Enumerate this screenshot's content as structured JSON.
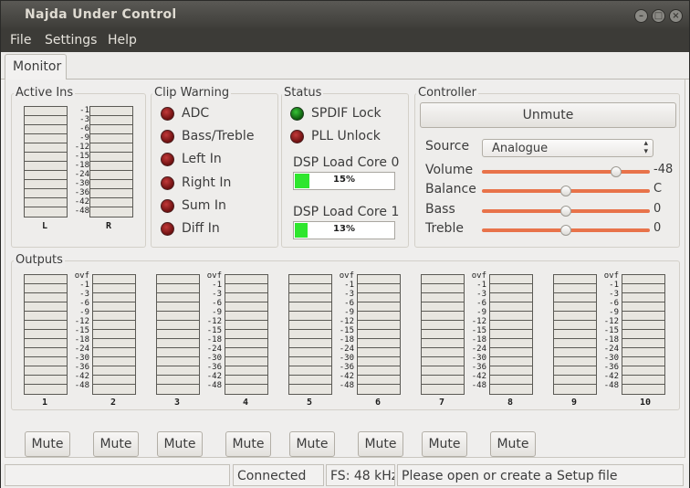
{
  "window": {
    "title": "Najda Under Control",
    "buttons": [
      "–",
      "□",
      "×"
    ]
  },
  "menu": [
    "File",
    "Settings",
    "Help"
  ],
  "tabs": [
    "Monitor"
  ],
  "scale_labels": [
    "-1",
    "-3",
    "-6",
    "-9",
    "-12",
    "-15",
    "-18",
    "-24",
    "-30",
    "-36",
    "-42",
    "-48"
  ],
  "overflow_label": "ovf",
  "active_ins": {
    "title": "Active Ins",
    "left_label": "L",
    "right_label": "R"
  },
  "clip_warning": {
    "title": "Clip Warning",
    "items": [
      "ADC",
      "Bass/Treble",
      "Left In",
      "Right In",
      "Sum In",
      "Diff In"
    ],
    "led_color": "#8c1c1c"
  },
  "status": {
    "title": "Status",
    "items": [
      {
        "label": "SPDIF Lock",
        "color": "green"
      },
      {
        "label": "PLL Unlock",
        "color": "red"
      }
    ],
    "dsp": [
      {
        "label": "DSP Load Core 0",
        "percent": 15,
        "text": "15%"
      },
      {
        "label": "DSP Load Core 1",
        "percent": 13,
        "text": "13%"
      }
    ]
  },
  "controller": {
    "title": "Controller",
    "unmute_label": "Unmute",
    "source_label": "Source",
    "source_value": "Analogue",
    "sliders": [
      {
        "label": "Volume",
        "value": "-48",
        "level": 0.8
      },
      {
        "label": "Balance",
        "value": "C",
        "level": 0.5
      },
      {
        "label": "Bass",
        "value": "0",
        "level": 0.5
      },
      {
        "label": "Treble",
        "value": "0",
        "level": 0.5
      }
    ],
    "accent": "#e8734a"
  },
  "outputs": {
    "title": "Outputs",
    "channels": [
      "1",
      "2",
      "3",
      "4",
      "5",
      "6",
      "7",
      "8",
      "9",
      "10"
    ]
  },
  "mute_buttons": [
    "Mute",
    "Mute",
    "Mute",
    "Mute",
    "Mute",
    "Mute",
    "Mute",
    "Mute"
  ],
  "statusbar": [
    "",
    "Connected",
    "FS: 48 kHz",
    "Please open or create a Setup file"
  ]
}
